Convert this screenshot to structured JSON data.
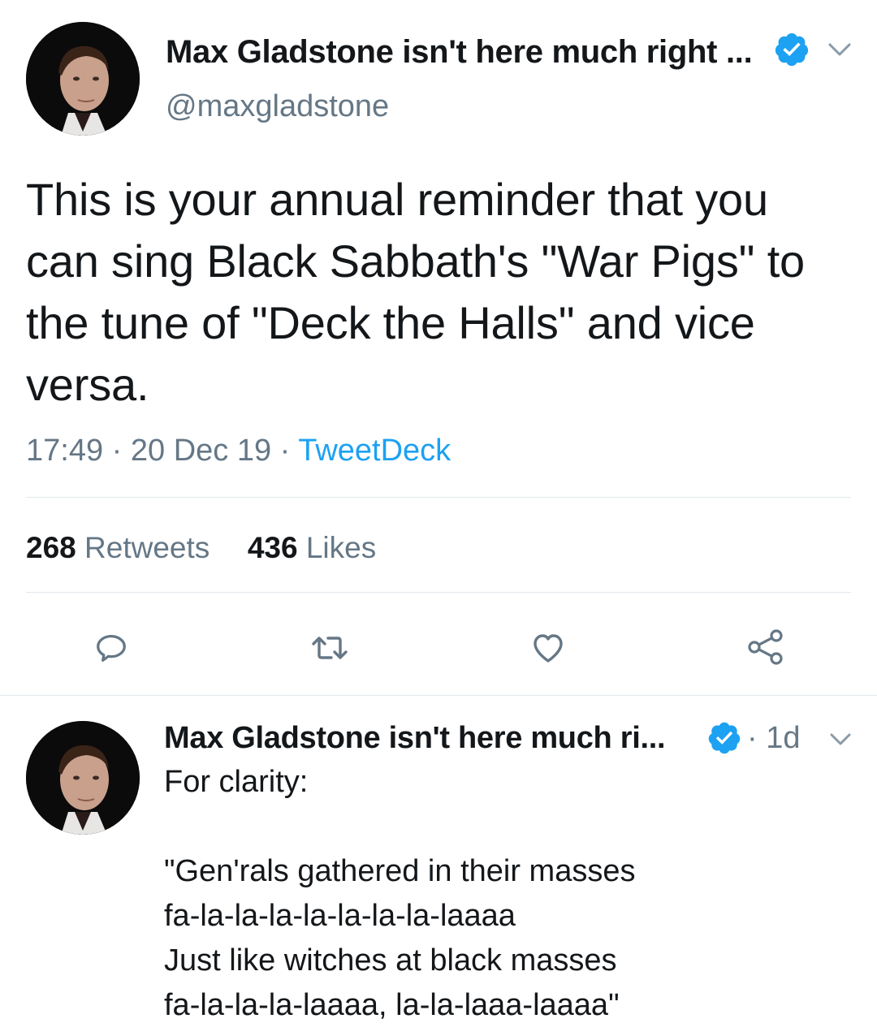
{
  "main_tweet": {
    "display_name": "Max Gladstone isn't here much right ...",
    "handle": "@maxgladstone",
    "text": "This is your annual reminder that you can sing Black Sabbath's \"War Pigs\" to the tune of \"Deck the Halls\" and vice versa.",
    "time": "17:49",
    "date": "20 Dec 19",
    "source": "TweetDeck",
    "retweet_count": "268",
    "retweet_label": "Retweets",
    "like_count": "436",
    "like_label": "Likes",
    "actions": [
      "reply-icon",
      "retweet-icon",
      "like-icon",
      "share-icon"
    ]
  },
  "reply": {
    "display_name": "Max Gladstone isn't here much ri...",
    "age": "1d",
    "lines": [
      "For clarity:",
      "",
      "\"Gen'rals gathered in their masses",
      "fa-la-la-la-la-la-la-la-laaaa",
      "Just like witches at black masses",
      "fa-la-la-la-laaaa, la-la-laaa-laaaa\""
    ]
  },
  "colors": {
    "accent": "#1da1f2",
    "secondary_text": "#657786",
    "divider": "#e1e8ed"
  }
}
